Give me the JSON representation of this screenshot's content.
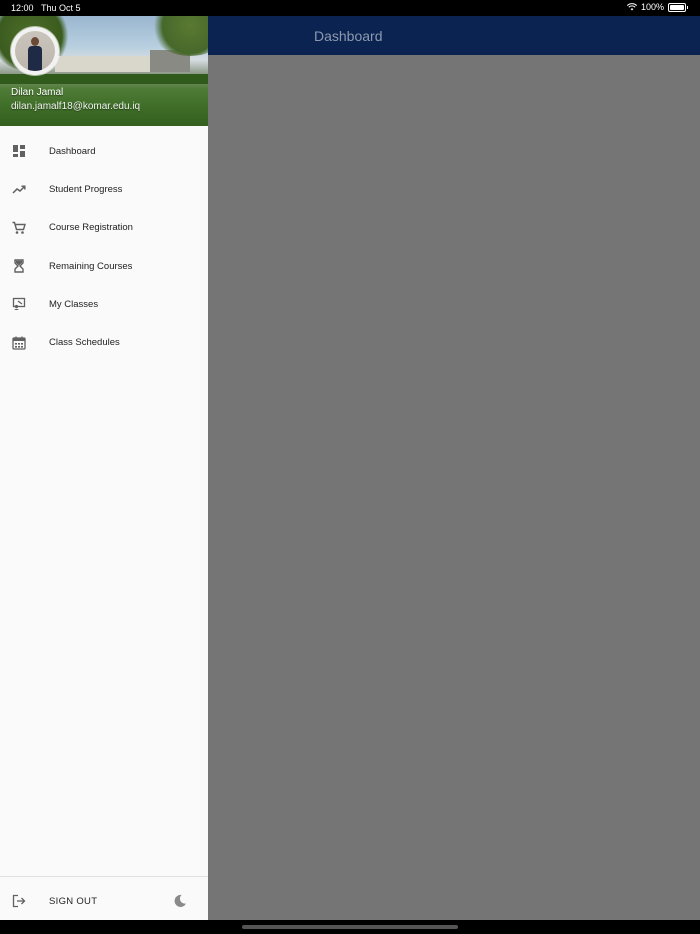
{
  "status_bar": {
    "time": "12:00",
    "date": "Thu Oct 5",
    "battery": "100%"
  },
  "appbar": {
    "title": "Dashboard"
  },
  "drawer": {
    "user": {
      "name": "Dilan Jamal",
      "email": "dilan.jamalf18@komar.edu.iq"
    },
    "items": [
      {
        "label": "Dashboard",
        "icon": "dashboard-icon"
      },
      {
        "label": "Student Progress",
        "icon": "trending-up-icon"
      },
      {
        "label": "Course Registration",
        "icon": "cart-icon"
      },
      {
        "label": "Remaining Courses",
        "icon": "hourglass-icon"
      },
      {
        "label": "My Classes",
        "icon": "classes-icon"
      },
      {
        "label": "Class Schedules",
        "icon": "calendar-icon"
      }
    ],
    "footer": {
      "signout_label": "SIGN OUT",
      "theme_icon": "moon-icon"
    }
  },
  "colors": {
    "appbar": "#0a2350",
    "scrim": "#757575",
    "drawer": "#fafafa",
    "icon": "#616161"
  }
}
